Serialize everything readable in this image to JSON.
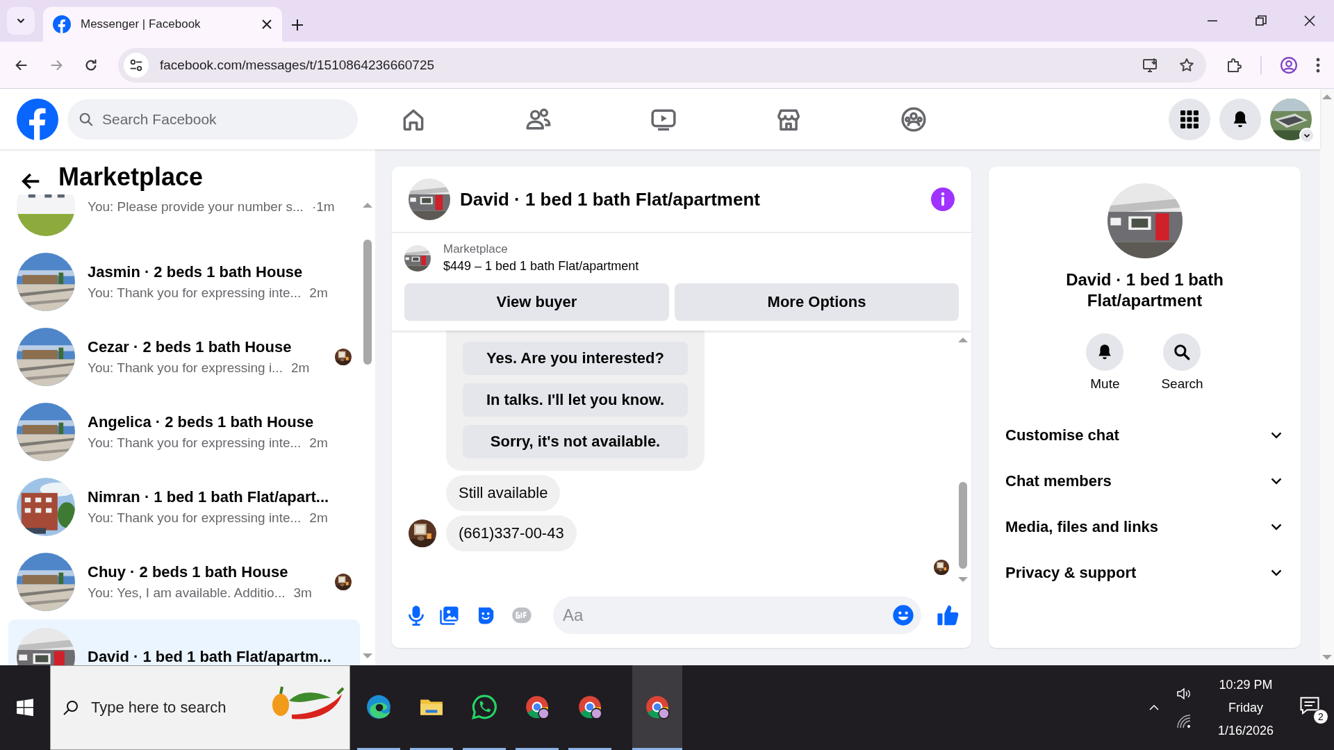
{
  "browser": {
    "tabs": [
      {
        "title": "Messenger | Facebook",
        "selected": true
      }
    ],
    "url": "facebook.com/messages/t/1510864236660725"
  },
  "facebook": {
    "search_placeholder": "Search Facebook"
  },
  "sidebar": {
    "title": "Marketplace",
    "conversations": [
      {
        "preview": "You: Please provide your number s...",
        "time": "·1m",
        "seen": false,
        "selected": false
      },
      {
        "title": "Jasmin · 2 beds 1 bath House",
        "preview": "You: Thank you for expressing inte...",
        "time": "2m",
        "seen": false,
        "selected": false
      },
      {
        "title": "Cezar · 2 beds 1 bath House",
        "preview": "You: Thank you for expressing i...",
        "time": "2m",
        "seen": true,
        "selected": false
      },
      {
        "title": "Angelica · 2 beds 1 bath House",
        "preview": "You: Thank you for expressing inte...",
        "time": "2m",
        "seen": false,
        "selected": false
      },
      {
        "title": "Nimran · 1 bed 1 bath Flat/apart...",
        "preview": "You: Thank you for expressing inte...",
        "time": "2m",
        "seen": false,
        "selected": false
      },
      {
        "title": "Chuy · 2 beds 1 bath House",
        "preview": "You: Yes, I am available. Additio...",
        "time": "3m",
        "seen": true,
        "selected": false
      },
      {
        "title": "David · 1 bed 1 bath Flat/apartm...",
        "selected": true
      }
    ]
  },
  "chat": {
    "title": "David · 1 bed 1 bath Flat/apartment",
    "listing": {
      "source": "Marketplace",
      "summary": "$449 – 1 bed 1 bath Flat/apartment"
    },
    "buttons": [
      "View buyer",
      "More Options"
    ],
    "quick_replies": [
      "Yes. Are you interested?",
      "In talks. I'll let you know.",
      "Sorry, it's not available."
    ],
    "messages": [
      {
        "text": "Still available",
        "avatar": false
      },
      {
        "text": "(661)337-00-43",
        "avatar": true
      }
    ],
    "seen": true,
    "composer": {
      "placeholder": "Aa"
    }
  },
  "details": {
    "name": "David · 1 bed 1 bath Flat/apartment",
    "actions": [
      {
        "label": "Mute",
        "kind": "bell"
      },
      {
        "label": "Search",
        "kind": "search"
      }
    ],
    "sections": [
      {
        "label": "Customise chat",
        "expanded": false
      },
      {
        "label": "Chat members",
        "expanded": false
      },
      {
        "label": "Media, files and links",
        "expanded": false
      },
      {
        "label": "Privacy & support",
        "expanded": false
      }
    ]
  },
  "taskbar": {
    "search_placeholder": "Type here to search",
    "apps": [
      {
        "kind": "edge",
        "selected": false
      },
      {
        "kind": "folder",
        "selected": false
      },
      {
        "kind": "whatsapp",
        "selected": false
      },
      {
        "kind": "chrome",
        "selected": false
      },
      {
        "kind": "chrome",
        "selected": false
      },
      {
        "kind": "chrome",
        "selected": true
      }
    ],
    "time": "10:29 PM",
    "day": "Friday",
    "date": "1/16/2026",
    "notifications": "2"
  }
}
